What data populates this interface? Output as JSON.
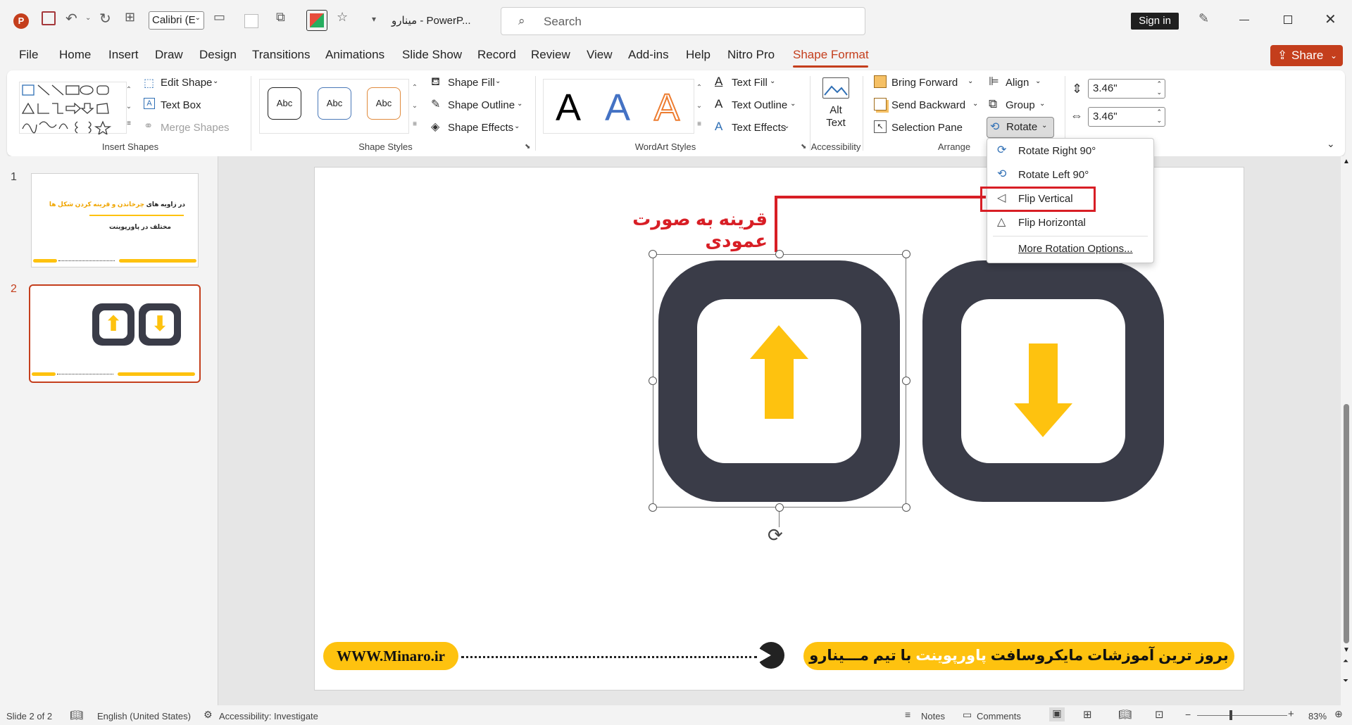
{
  "titlebar": {
    "font_name": "Calibri (E",
    "doc_title": "مینارو  -  PowerP...",
    "search_placeholder": "Search",
    "sign_in": "Sign in"
  },
  "tabs": [
    "File",
    "Home",
    "Insert",
    "Draw",
    "Design",
    "Transitions",
    "Animations",
    "Slide Show",
    "Record",
    "Review",
    "View",
    "Add-ins",
    "Help",
    "Nitro Pro",
    "Shape Format"
  ],
  "active_tab": "Shape Format",
  "share_label": "Share",
  "ribbon": {
    "insert_shapes": {
      "edit_shape": "Edit Shape",
      "text_box": "Text Box",
      "merge_shapes": "Merge Shapes",
      "label": "Insert Shapes"
    },
    "shape_styles": {
      "sample": "Abc",
      "shape_fill": "Shape Fill",
      "shape_outline": "Shape Outline",
      "shape_effects": "Shape Effects",
      "label": "Shape Styles"
    },
    "wordart": {
      "letter": "A",
      "text_fill": "Text Fill",
      "text_outline": "Text Outline",
      "text_effects": "Text Effects",
      "label": "WordArt Styles"
    },
    "accessibility": {
      "alt_text_line1": "Alt",
      "alt_text_line2": "Text",
      "label": "Accessibility"
    },
    "arrange": {
      "bring_forward": "Bring Forward",
      "send_backward": "Send Backward",
      "selection_pane": "Selection Pane",
      "align": "Align",
      "group": "Group",
      "rotate": "Rotate",
      "label": "Arrange"
    },
    "size": {
      "height": "3.46\"",
      "width": "3.46\""
    }
  },
  "rotate_menu": {
    "items": [
      "Rotate Right 90°",
      "Rotate Left 90°",
      "Flip Vertical",
      "Flip Horizontal"
    ],
    "more": "More Rotation Options..."
  },
  "thumbnails": {
    "numbers": [
      "1",
      "2"
    ],
    "slide1_title_a": "چرخاندن و قرینه کردن شکل ها",
    "slide1_title_b": "در زاویه های",
    "slide1_subtitle": "مختلف در پاورپوینت"
  },
  "slide": {
    "annotation": "قرینه به صورت عمودی",
    "website": "WWW.Minaro.ir",
    "footer_a": "بروز ترین آموزشات مایکروسافت",
    "footer_b": "پاورپوینت",
    "footer_c": "با تیم مـــینارو"
  },
  "status": {
    "slide_info": "Slide 2 of 2",
    "language": "English (United States)",
    "accessibility": "Accessibility: Investigate",
    "notes": "Notes",
    "comments": "Comments",
    "zoom": "83%"
  },
  "colors": {
    "accent": "#c43e1c",
    "arrow_yellow": "#fec20f",
    "badge_dark": "#3a3c48",
    "annotation_red": "#d81e25"
  }
}
